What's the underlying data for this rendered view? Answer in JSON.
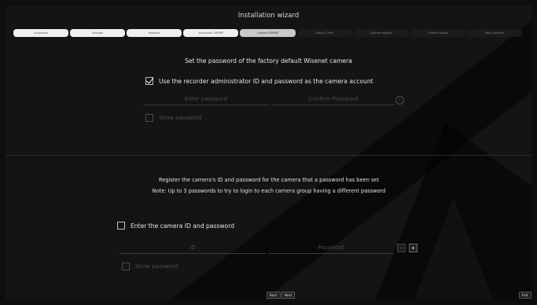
{
  "window": {
    "title": "Installation wizard"
  },
  "steps": [
    {
      "label": "Language",
      "state": "done"
    },
    {
      "label": "Storage",
      "state": "done"
    },
    {
      "label": "Network",
      "state": "done"
    },
    {
      "label": "Activation EXPIRE",
      "state": "done"
    },
    {
      "label": "License EXPIRE",
      "state": "active"
    },
    {
      "label": "Date & Time",
      "state": "todo"
    },
    {
      "label": "Camera register",
      "state": "todo"
    },
    {
      "label": "Channel setup",
      "state": "todo"
    },
    {
      "label": "Easy connect",
      "state": "todo"
    }
  ],
  "section1": {
    "heading": "Set the password of the factory default Wisenet camera",
    "use_admin_label": "Use the recorder administrator ID and password as the camera account",
    "use_admin_checked": true,
    "enter_password_placeholder": "Enter password",
    "confirm_password_placeholder": "Confirm Password",
    "info_glyph": "i",
    "show_password_label": "Show password"
  },
  "section2": {
    "note_line1": "Register the camera's ID and password for the camera that a password has been set",
    "note_line2": "Note: Up to 3 passwords to try to login to each camera group having a different password",
    "enter_id_label": "Enter the camera ID and password",
    "enter_id_checked": false,
    "id_placeholder": "ID",
    "password_placeholder": "Password",
    "minus_glyph": "−",
    "plus_glyph": "+",
    "show_password_label": "Show password"
  },
  "footer": {
    "back_label": "Back",
    "next_label": "Next",
    "exit_label": "Exit"
  },
  "colors": {
    "background": "#141414",
    "text": "#e6e6e6",
    "disabled": "#4a4a4a"
  },
  "icons": {
    "watermark": "wisenet-logo-watermark"
  }
}
